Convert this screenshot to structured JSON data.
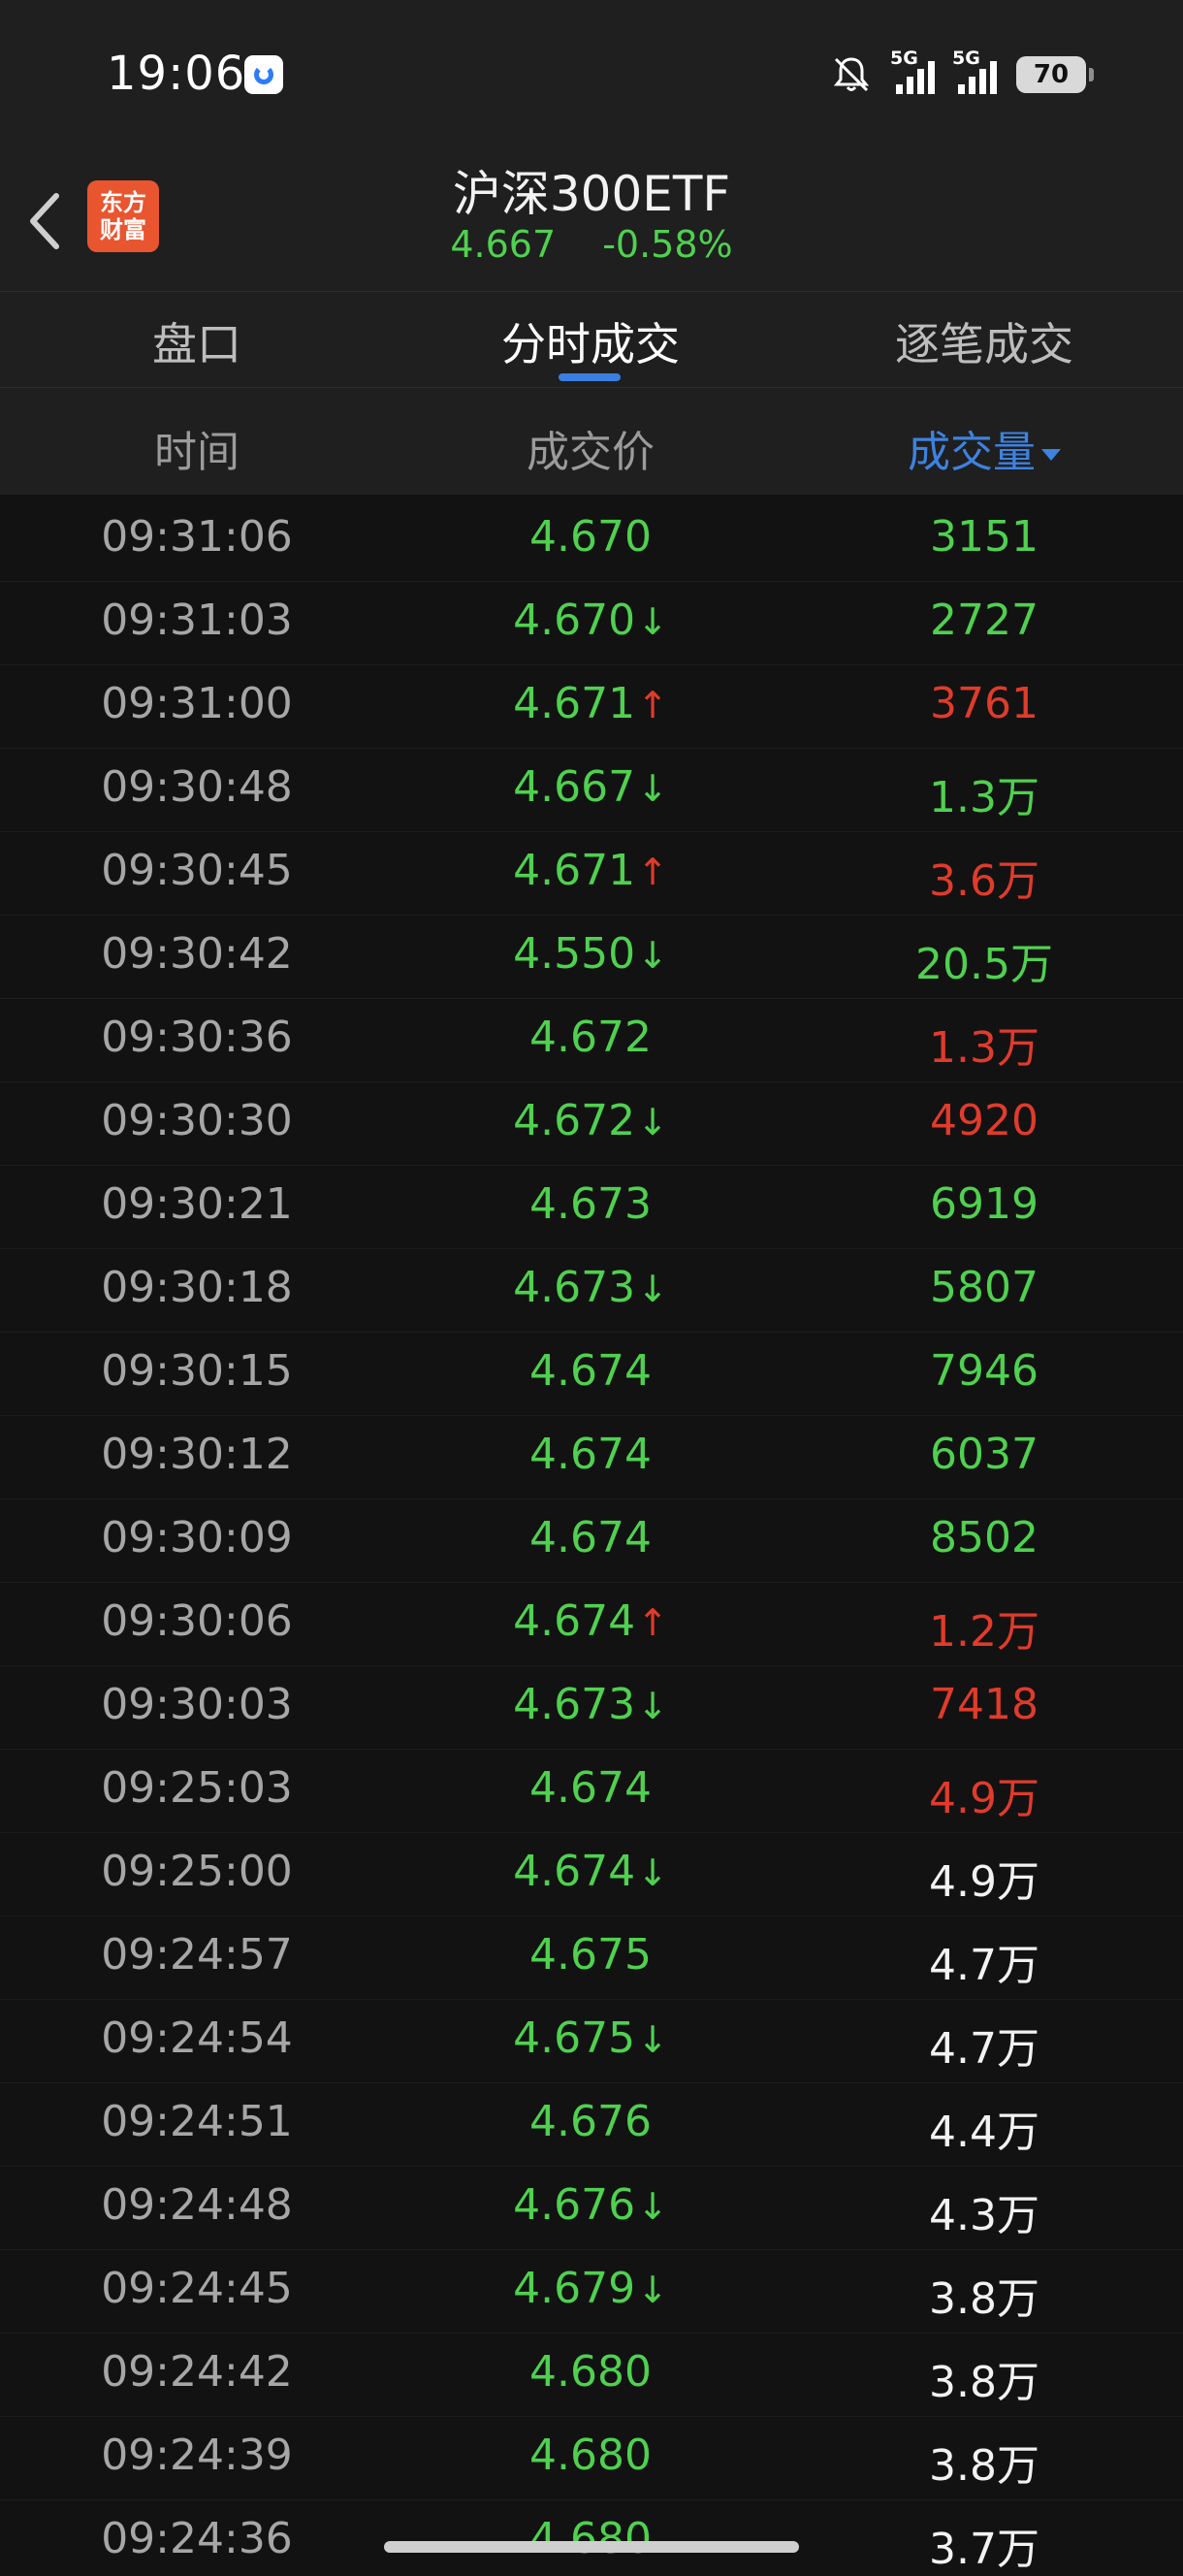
{
  "status_bar": {
    "time": "19:06",
    "network1": "5G",
    "network2": "5G",
    "battery": "70"
  },
  "header": {
    "logo_line1": "东方",
    "logo_line2": "财富",
    "title": "沪深300ETF",
    "price": "4.667",
    "change": "-0.58%"
  },
  "tabs": [
    {
      "label": "盘口"
    },
    {
      "label": "分时成交"
    },
    {
      "label": "逐笔成交"
    }
  ],
  "columns": {
    "time": "时间",
    "price": "成交价",
    "volume": "成交量"
  },
  "rows": [
    {
      "time": "09:31:06",
      "price": "4.670",
      "arrow": "",
      "volume": "3151",
      "vol_color": "green"
    },
    {
      "time": "09:31:03",
      "price": "4.670",
      "arrow": "↓",
      "volume": "2727",
      "vol_color": "green"
    },
    {
      "time": "09:31:00",
      "price": "4.671",
      "arrow": "↑",
      "volume": "3761",
      "vol_color": "red"
    },
    {
      "time": "09:30:48",
      "price": "4.667",
      "arrow": "↓",
      "volume": "1.3万",
      "vol_color": "green"
    },
    {
      "time": "09:30:45",
      "price": "4.671",
      "arrow": "↑",
      "volume": "3.6万",
      "vol_color": "red"
    },
    {
      "time": "09:30:42",
      "price": "4.550",
      "arrow": "↓",
      "volume": "20.5万",
      "vol_color": "green"
    },
    {
      "time": "09:30:36",
      "price": "4.672",
      "arrow": "",
      "volume": "1.3万",
      "vol_color": "red"
    },
    {
      "time": "09:30:30",
      "price": "4.672",
      "arrow": "↓",
      "volume": "4920",
      "vol_color": "red"
    },
    {
      "time": "09:30:21",
      "price": "4.673",
      "arrow": "",
      "volume": "6919",
      "vol_color": "green"
    },
    {
      "time": "09:30:18",
      "price": "4.673",
      "arrow": "↓",
      "volume": "5807",
      "vol_color": "green"
    },
    {
      "time": "09:30:15",
      "price": "4.674",
      "arrow": "",
      "volume": "7946",
      "vol_color": "green"
    },
    {
      "time": "09:30:12",
      "price": "4.674",
      "arrow": "",
      "volume": "6037",
      "vol_color": "green"
    },
    {
      "time": "09:30:09",
      "price": "4.674",
      "arrow": "",
      "volume": "8502",
      "vol_color": "green"
    },
    {
      "time": "09:30:06",
      "price": "4.674",
      "arrow": "↑",
      "volume": "1.2万",
      "vol_color": "red"
    },
    {
      "time": "09:30:03",
      "price": "4.673",
      "arrow": "↓",
      "volume": "7418",
      "vol_color": "red"
    },
    {
      "time": "09:25:03",
      "price": "4.674",
      "arrow": "",
      "volume": "4.9万",
      "vol_color": "red"
    },
    {
      "time": "09:25:00",
      "price": "4.674",
      "arrow": "↓",
      "volume": "4.9万",
      "vol_color": "white"
    },
    {
      "time": "09:24:57",
      "price": "4.675",
      "arrow": "",
      "volume": "4.7万",
      "vol_color": "white"
    },
    {
      "time": "09:24:54",
      "price": "4.675",
      "arrow": "↓",
      "volume": "4.7万",
      "vol_color": "white"
    },
    {
      "time": "09:24:51",
      "price": "4.676",
      "arrow": "",
      "volume": "4.4万",
      "vol_color": "white"
    },
    {
      "time": "09:24:48",
      "price": "4.676",
      "arrow": "↓",
      "volume": "4.3万",
      "vol_color": "white"
    },
    {
      "time": "09:24:45",
      "price": "4.679",
      "arrow": "↓",
      "volume": "3.8万",
      "vol_color": "white"
    },
    {
      "time": "09:24:42",
      "price": "4.680",
      "arrow": "",
      "volume": "3.8万",
      "vol_color": "white"
    },
    {
      "time": "09:24:39",
      "price": "4.680",
      "arrow": "",
      "volume": "3.8万",
      "vol_color": "white"
    },
    {
      "time": "09:24:36",
      "price": "4.680",
      "arrow": "",
      "volume": "3.7万",
      "vol_color": "white"
    }
  ],
  "colors": {
    "up": "#e03b2b",
    "down": "#4fd14f",
    "neutral": "#f2f2f2",
    "accent": "#3d82df"
  }
}
